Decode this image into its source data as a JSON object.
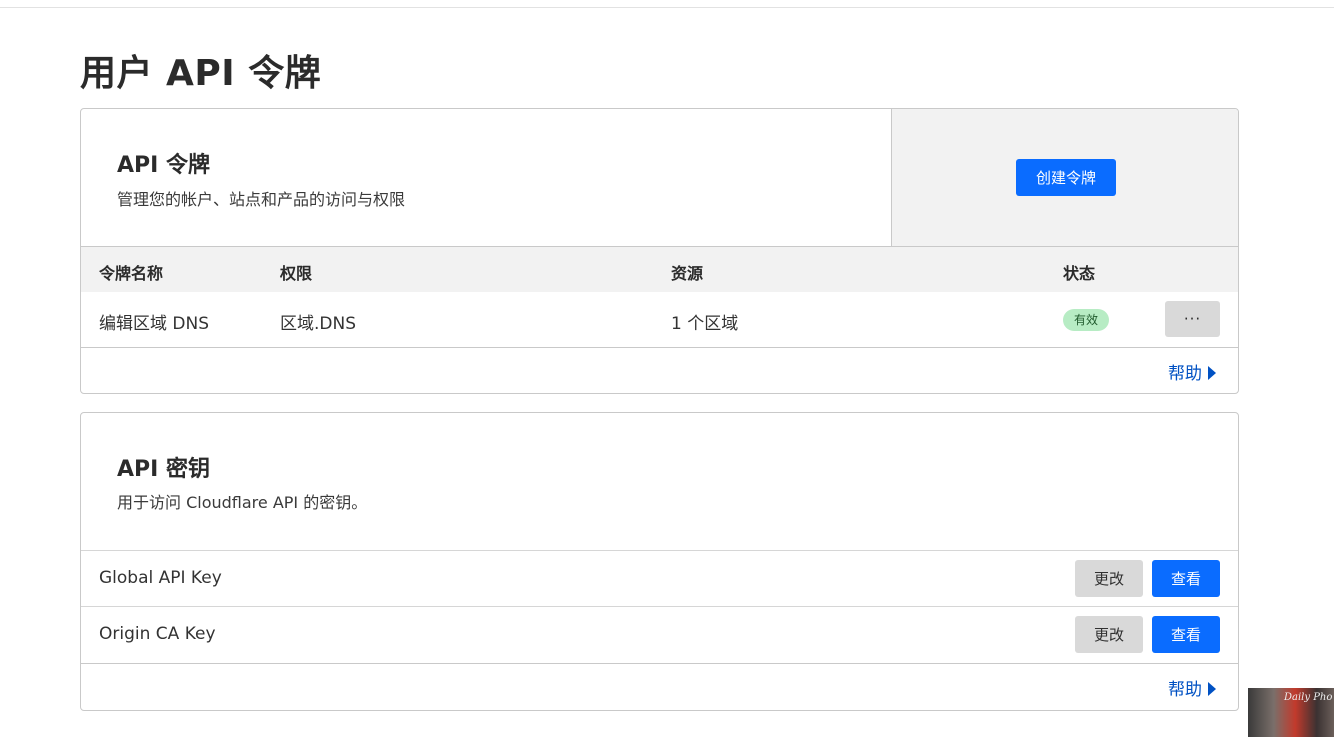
{
  "page": {
    "title": "用户 API 令牌"
  },
  "tokens_card": {
    "title": "API 令牌",
    "description": "管理您的帐户、站点和产品的访问与权限",
    "create_button": "创建令牌",
    "columns": [
      "令牌名称",
      "权限",
      "资源",
      "状态"
    ],
    "rows": [
      {
        "name": "编辑区域 DNS",
        "permission": "区域.DNS",
        "resource": "1 个区域",
        "status": "有效",
        "more_label": "···"
      }
    ],
    "help_link": "帮助"
  },
  "keys_card": {
    "title": "API 密钥",
    "description": "用于访问 Cloudflare API 的密钥。",
    "keys": [
      {
        "name": "Global API Key",
        "change_label": "更改",
        "view_label": "查看"
      },
      {
        "name": "Origin CA Key",
        "change_label": "更改",
        "view_label": "查看"
      }
    ],
    "help_link": "帮助"
  },
  "overlay": {
    "thumbnail_text": "Daily Pho"
  },
  "colors": {
    "primary": "#0a6cff",
    "link": "#0051c3",
    "badge_bg": "#b7ecc4",
    "header_bg": "#f2f2f2"
  },
  "icons": {
    "help": "caret-right-icon",
    "more": "ellipsis-icon"
  }
}
